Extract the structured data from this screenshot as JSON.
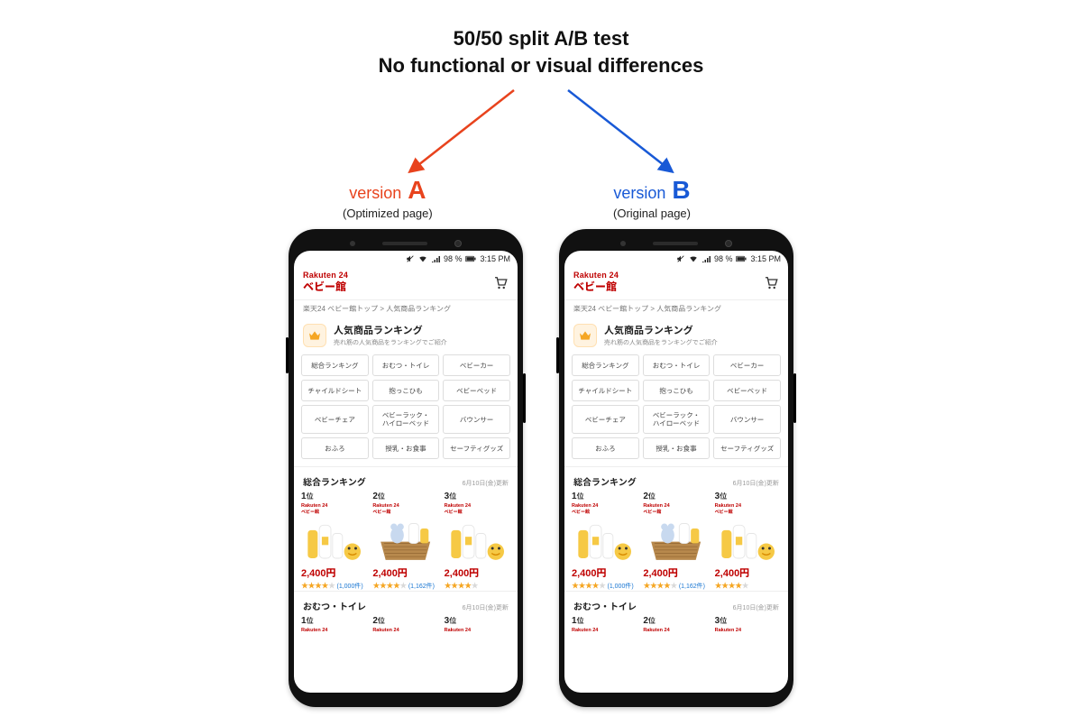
{
  "headline": {
    "line1": "50/50 split A/B test",
    "line2": "No functional or visual differences"
  },
  "versions": {
    "a": {
      "word": "version",
      "letter": "A",
      "subtitle": "(Optimized page)"
    },
    "b": {
      "word": "version",
      "letter": "B",
      "subtitle": "(Original page)"
    }
  },
  "statusbar": {
    "battery": "98 %",
    "time": "3:15 PM"
  },
  "brand": {
    "top": "Rakuten 24",
    "sub": "ベビー館"
  },
  "breadcrumb": "楽天24 ベビー館トップ > 人気商品ランキング",
  "rankingHeader": {
    "title": "人気商品ランキング",
    "sub": "売れ筋の人気商品をランキングでご紹介"
  },
  "categories": [
    "総合ランキング",
    "おむつ・トイレ",
    "ベビーカー",
    "チャイルドシート",
    "抱っこひも",
    "ベビーベッド",
    "ベビーチェア",
    "ベビーラック・\nハイローベッド",
    "バウンサー",
    "おふろ",
    "授乳・お食事",
    "セーフティグッズ"
  ],
  "sections": {
    "overall": {
      "title": "総合ランキング",
      "date": "6月10日(金)更新",
      "items": [
        {
          "rank": "1",
          "suffix": "位",
          "brandTop": "Rakuten 24",
          "brandSub": "ベビー館",
          "price": "2,400円",
          "reviews": "(1,000件)"
        },
        {
          "rank": "2",
          "suffix": "位",
          "brandTop": "Rakuten 24",
          "brandSub": "ベビー館",
          "price": "2,400円",
          "reviews": "(1,162件)"
        },
        {
          "rank": "3",
          "suffix": "位",
          "brandTop": "Rakuten 24",
          "brandSub": "ベビー館",
          "price": "2,400円",
          "reviews": ""
        }
      ]
    },
    "diaper": {
      "title": "おむつ・トイレ",
      "date": "6月10日(金)更新",
      "items": [
        {
          "rank": "1",
          "suffix": "位",
          "brandTop": "Rakuten 24"
        },
        {
          "rank": "2",
          "suffix": "位",
          "brandTop": "Rakuten 24"
        },
        {
          "rank": "3",
          "suffix": "位",
          "brandTop": "Rakuten 24"
        }
      ]
    }
  }
}
